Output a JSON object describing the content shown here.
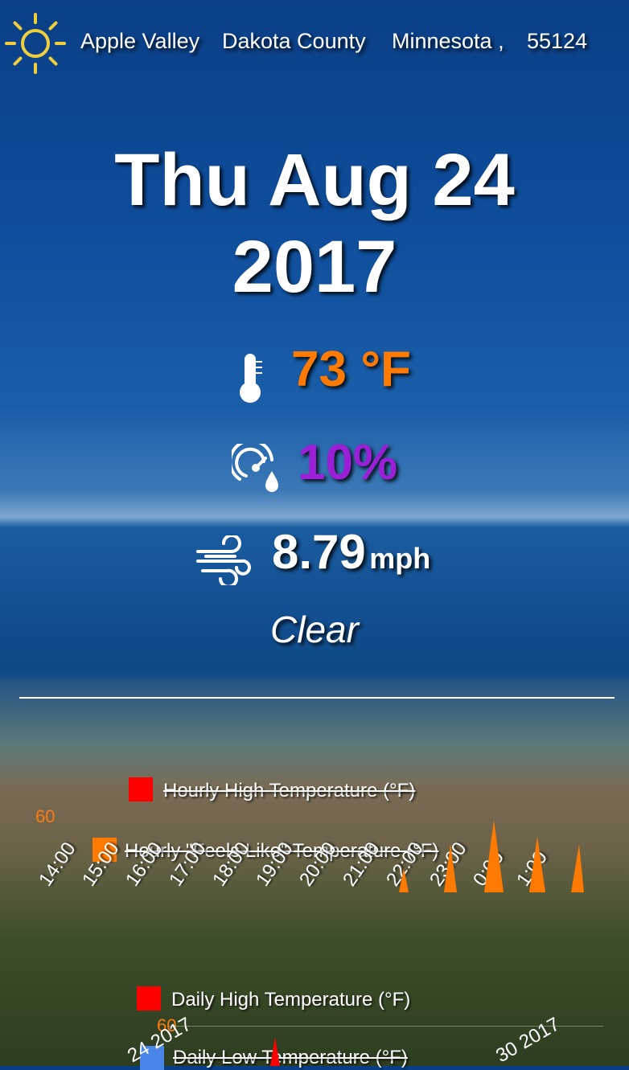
{
  "header": {
    "city": "Apple Valley",
    "county": "Dakota County",
    "state": "Minnesota ,",
    "zip": "55124",
    "icon": "sun-icon"
  },
  "date": {
    "line1": "Thu Aug 24",
    "line2": "2017"
  },
  "temperature": {
    "value": "73 °F",
    "icon": "thermometer-icon",
    "color": "#ff7a00"
  },
  "humidity": {
    "value": "10%",
    "icon": "humidity-gauge-icon",
    "color": "#9b1fd6"
  },
  "wind": {
    "value": "8.79",
    "unit": "mph",
    "icon": "wind-icon"
  },
  "condition": "Clear",
  "hourly_chart": {
    "legend": [
      {
        "label": "Hourly High Temperature (°F)",
        "color": "#ff0000"
      },
      {
        "label": "Hourly \"Feels Like\" Temperature (°F)",
        "color": "#ff7a00"
      }
    ],
    "y_label": "60",
    "x_ticks": [
      "14:00",
      "15:00",
      "16:00",
      "17:00",
      "18:00",
      "19:00",
      "20:00",
      "21:00",
      "22:00",
      "23:00",
      "0:00",
      "1:00"
    ]
  },
  "daily_chart": {
    "legend": [
      {
        "label": "Daily High Temperature (°F)",
        "color": "#ff0000"
      },
      {
        "label": "Daily Low Temperature (°F)",
        "color": "#4a86e8"
      }
    ],
    "y_label": "60",
    "x_ticks": [
      "24 2017",
      "30 2017"
    ]
  }
}
